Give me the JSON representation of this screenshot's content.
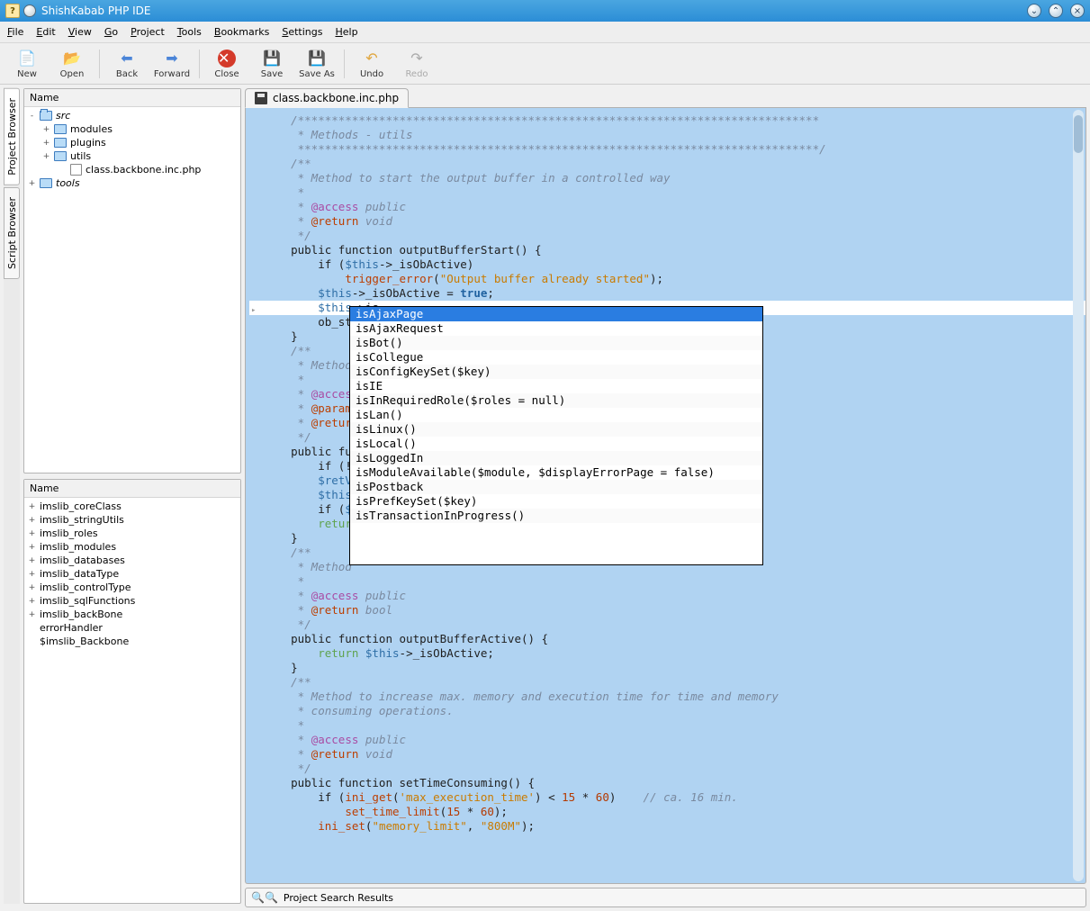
{
  "titlebar": {
    "title": "ShishKabab PHP IDE"
  },
  "menu": {
    "file": "File",
    "edit": "Edit",
    "view": "View",
    "go": "Go",
    "project": "Project",
    "tools": "Tools",
    "bookmarks": "Bookmarks",
    "settings": "Settings",
    "help": "Help"
  },
  "toolbar": {
    "new": "New",
    "open": "Open",
    "back": "Back",
    "forward": "Forward",
    "close": "Close",
    "save": "Save",
    "saveas": "Save As",
    "undo": "Undo",
    "redo": "Redo"
  },
  "sidetabs": {
    "project": "Project Browser",
    "script": "Script Browser"
  },
  "project_panel": {
    "header": "Name",
    "tree": {
      "src": "src",
      "modules": "modules",
      "plugins": "plugins",
      "utils": "utils",
      "file1": "class.backbone.inc.php",
      "tools": "tools"
    }
  },
  "script_panel": {
    "header": "Name",
    "items": [
      "imslib_coreClass",
      "imslib_stringUtils",
      "imslib_roles",
      "imslib_modules",
      "imslib_databases",
      "imslib_dataType",
      "imslib_controlType",
      "imslib_sqlFunctions",
      "imslib_backBone",
      "errorHandler",
      "$imslib_Backbone"
    ]
  },
  "editor": {
    "tab_label": "class.backbone.inc.php",
    "lines": [
      {
        "t": "comment",
        "v": "    /*****************************************************************************"
      },
      {
        "t": "comment",
        "v": "     * Methods - utils"
      },
      {
        "t": "comment",
        "v": "     *****************************************************************************/"
      },
      {
        "t": "comment",
        "v": "    /**"
      },
      {
        "t": "comment",
        "v": "     * Method to start the output buffer in a controlled way"
      },
      {
        "t": "comment",
        "v": "     *"
      },
      {
        "t": "taggedA",
        "v": "     * @access public"
      },
      {
        "t": "taggedR",
        "v": "     * @return void"
      },
      {
        "t": "comment",
        "v": "     */"
      },
      {
        "t": "code",
        "v": "    public function outputBufferStart() {"
      },
      {
        "t": "ifthis",
        "v": "        if ($this->_isObActive)"
      },
      {
        "t": "trigger",
        "v": "            trigger_error(\"Output buffer already started\");"
      },
      {
        "t": "assignTrue",
        "v": "        $this->_isObActive = true;"
      },
      {
        "t": "highlight",
        "v": "        $this->is"
      },
      {
        "t": "obstart",
        "v": "        ob_sta"
      },
      {
        "t": "code",
        "v": "    }"
      },
      {
        "t": "comment",
        "v": "    /**"
      },
      {
        "t": "comment",
        "v": "     * Method"
      },
      {
        "t": "comment",
        "v": "     *"
      },
      {
        "t": "taggedA",
        "v": "     * @access"
      },
      {
        "t": "taggedP",
        "v": "     * @param"
      },
      {
        "t": "taggedR",
        "v": "     * @return"
      },
      {
        "t": "comment",
        "v": "     */"
      },
      {
        "t": "code",
        "v": "    public fun"
      },
      {
        "t": "ifnot",
        "v": "        if (!$"
      },
      {
        "t": "retva",
        "v": "        $retVa"
      },
      {
        "t": "thisCut",
        "v": "        $this-"
      },
      {
        "t": "ifm",
        "v": "        if ($m"
      },
      {
        "t": "return",
        "v": "        return"
      },
      {
        "t": "code",
        "v": "    }"
      },
      {
        "t": "comment",
        "v": "    /**"
      },
      {
        "t": "comment",
        "v": "     * Method"
      },
      {
        "t": "comment",
        "v": "     *"
      },
      {
        "t": "taggedA",
        "v": "     * @access public"
      },
      {
        "t": "taggedRbool",
        "v": "     * @return bool"
      },
      {
        "t": "comment",
        "v": "     */"
      },
      {
        "t": "code",
        "v": "    public function outputBufferActive() {"
      },
      {
        "t": "returnThis",
        "v": "        return $this->_isObActive;"
      },
      {
        "t": "code",
        "v": "    }"
      },
      {
        "t": "comment",
        "v": "    /**"
      },
      {
        "t": "comment",
        "v": "     * Method to increase max. memory and execution time for time and memory"
      },
      {
        "t": "comment",
        "v": "     * consuming operations."
      },
      {
        "t": "comment",
        "v": "     *"
      },
      {
        "t": "taggedA",
        "v": "     * @access public"
      },
      {
        "t": "taggedR",
        "v": "     * @return void"
      },
      {
        "t": "comment",
        "v": "     */"
      },
      {
        "t": "code",
        "v": "    public function setTimeConsuming() {"
      },
      {
        "t": "iniget",
        "v": "        if (ini_get('max_execution_time') < 15 * 60)    // ca. 16 min."
      },
      {
        "t": "settime",
        "v": "            set_time_limit(15 * 60);"
      },
      {
        "t": "iniset",
        "v": "        ini_set(\"memory_limit\", \"800M\");"
      }
    ]
  },
  "autocomplete": [
    "isAjaxPage",
    "isAjaxRequest",
    "isBot()",
    "isCollegue",
    "isConfigKeySet($key)",
    "isIE",
    "isInRequiredRole($roles = null)",
    "isLan()",
    "isLinux()",
    "isLocal()",
    "isLoggedIn",
    "isModuleAvailable($module, $displayErrorPage = false)",
    "isPostback",
    "isPrefKeySet($key)",
    "isTransactionInProgress()"
  ],
  "bottom": {
    "search_results": "Project Search Results"
  }
}
